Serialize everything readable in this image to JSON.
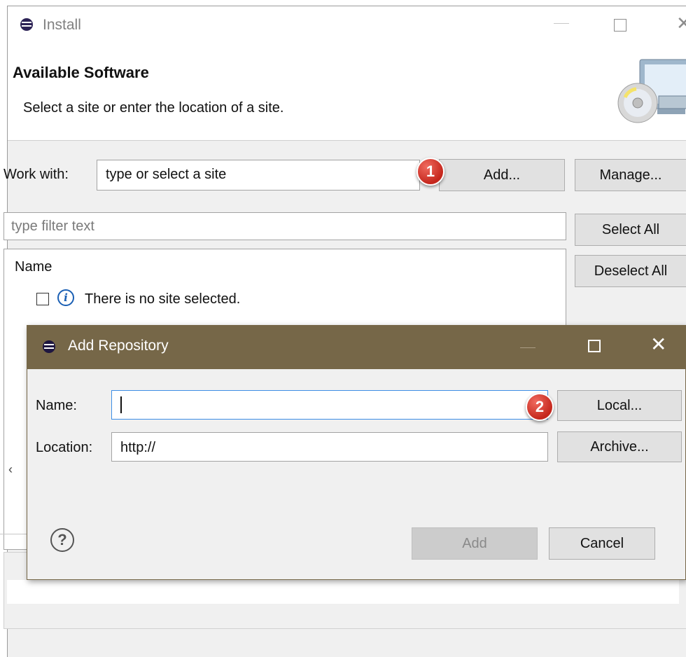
{
  "window": {
    "title": "Install",
    "close_glyph": "✕"
  },
  "header": {
    "title": "Available Software",
    "description": "Select a site or enter the location of a site.",
    "image_icon": "cd-computer-icon"
  },
  "work_with": {
    "label": "Work with:",
    "value": "type or select a site",
    "add_button": "Add...",
    "manage_button": "Manage..."
  },
  "filter": {
    "placeholder": "type filter text"
  },
  "side_buttons": {
    "select_all": "Select All",
    "deselect_all": "Deselect All"
  },
  "tree": {
    "column_header": "Name",
    "info_glyph": "i",
    "message": "There is no site selected.",
    "scroll_glyph": "‹"
  },
  "callouts": [
    "1",
    "2"
  ],
  "dialog": {
    "title": "Add Repository",
    "close_glyph": "✕",
    "name_label": "Name:",
    "name_value": "",
    "location_label": "Location:",
    "location_value": "http://",
    "local_button": "Local...",
    "archive_button": "Archive...",
    "help_glyph": "?",
    "add_button": "Add",
    "cancel_button": "Cancel"
  },
  "colors": {
    "dialog_titlebar": "#766748",
    "callout": "#d9362b",
    "focus_border": "#3d8ee6"
  }
}
